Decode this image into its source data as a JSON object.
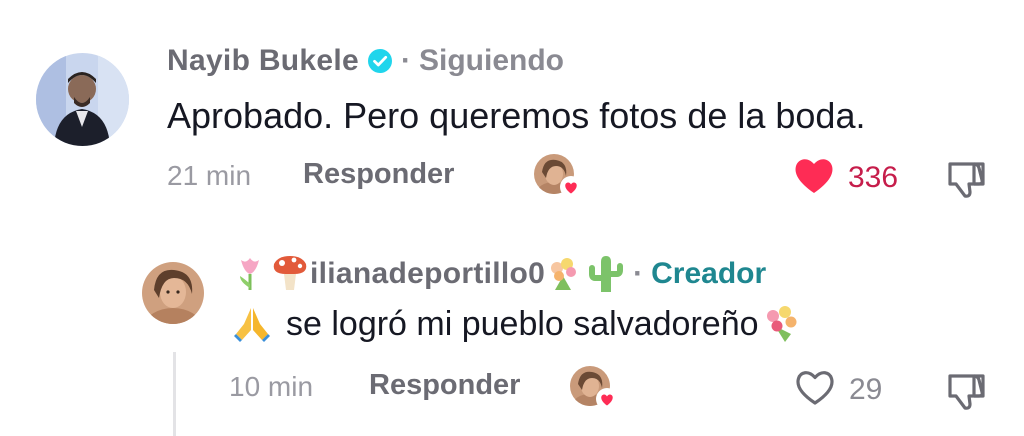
{
  "comments": [
    {
      "username": "Nayib Bukele",
      "verified": true,
      "separator": "·",
      "follow_status": "Siguiendo",
      "text": "Aprobado. Pero queremos fotos de la boda.",
      "time": "21 min",
      "reply_label": "Responder",
      "creator_liked": true,
      "liked": true,
      "like_count": "336"
    },
    {
      "username_prefix_emojis": "🌷🍄",
      "username": "ilianadeportillo0",
      "username_suffix_emojis": "💐🌵",
      "separator": "·",
      "creator_tag": "Creador",
      "text_prefix_emoji": "🙏",
      "text": "se logró mi pueblo salvadoreño",
      "text_suffix_emoji": "💐",
      "time": "10 min",
      "reply_label": "Responder",
      "creator_liked": true,
      "liked": false,
      "like_count": "29"
    }
  ],
  "colors": {
    "like_active": "#fe2c55",
    "verified": "#20d5ec",
    "creator_tag": "#1f8790"
  },
  "icons": {
    "verified": "verified-check-icon",
    "like": "heart-icon",
    "dislike": "thumbs-down-icon",
    "creator_like": "creator-heart-icon"
  }
}
